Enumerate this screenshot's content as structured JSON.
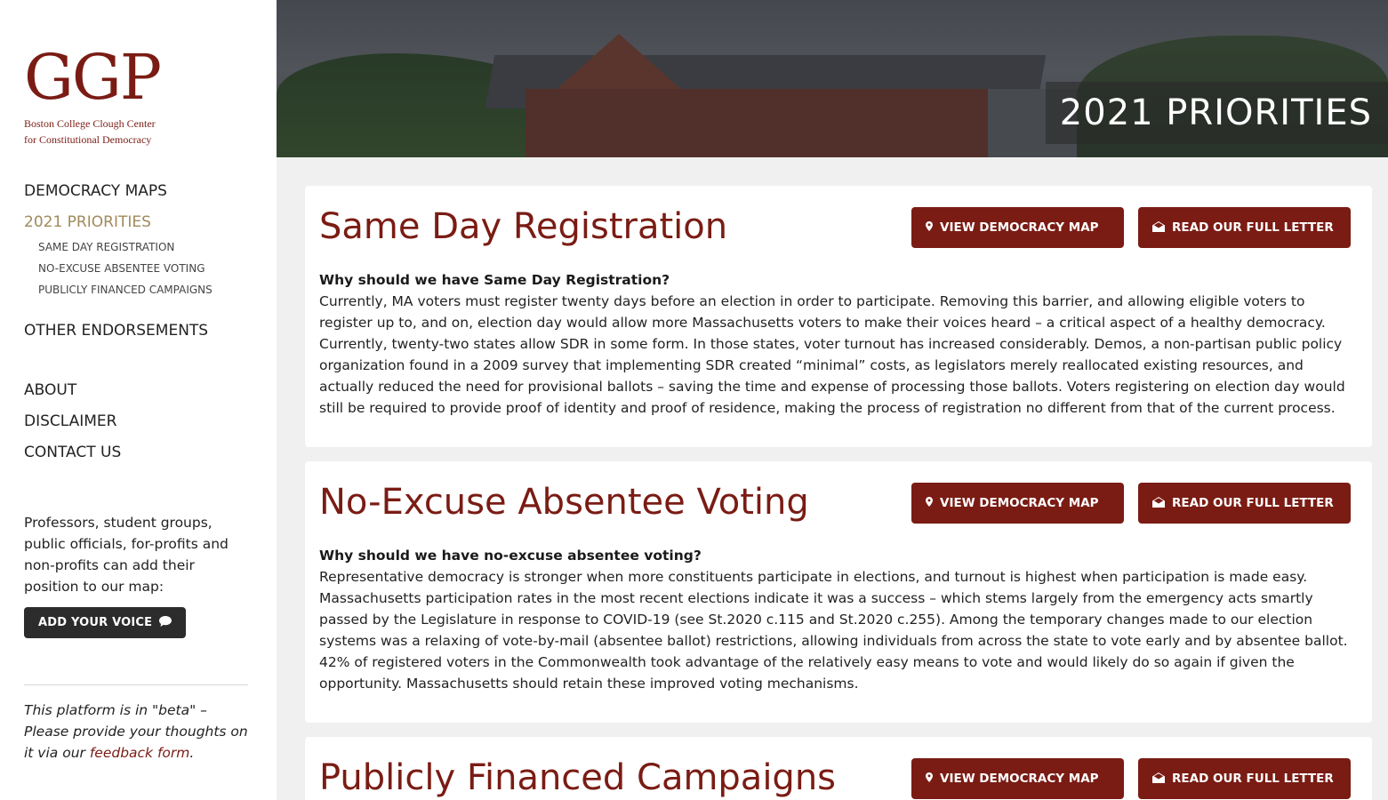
{
  "logo": {
    "mark": "GGP",
    "line1": "Boston College Clough Center",
    "line2": "for Constitutional Democracy"
  },
  "nav": {
    "democracy_maps": "DEMOCRACY MAPS",
    "priorities": "2021 PRIORITIES",
    "sub": [
      "SAME DAY REGISTRATION",
      "NO-EXCUSE ABSENTEE VOTING",
      "PUBLICLY FINANCED CAMPAIGNS"
    ],
    "other": "OTHER ENDORSEMENTS",
    "about": "ABOUT",
    "disclaimer": "DISCLAIMER",
    "contact": "CONTACT US"
  },
  "promo": {
    "text": "Professors, student groups, public officials, for-profits and non-profits can add their position to our map:",
    "button": "ADD YOUR VOICE"
  },
  "beta": {
    "before": "This platform is in \"beta\" – Please provide your thoughts on it via our ",
    "link": "feedback form",
    "after": "."
  },
  "banner": {
    "title": "2021 PRIORITIES"
  },
  "buttons": {
    "map": "VIEW DEMOCRACY MAP",
    "letter": "READ OUR FULL LETTER"
  },
  "cards": [
    {
      "title": "Same Day Registration",
      "question": "Why should we have Same Day Registration?",
      "body": "Currently, MA voters must register twenty days before an election in order to participate. Removing this barrier, and allowing eligible voters to register up to, and on, election day would allow more Massachusetts voters to make their voices heard – a critical aspect of a healthy democracy. Currently, twenty-two states allow SDR in some form. In those states, voter turnout has increased considerably. Demos, a non-partisan public policy organization found in a 2009 survey that implementing SDR created “minimal” costs, as legislators merely reallocated existing resources, and actually reduced the need for provisional ballots – saving the time and expense of processing those ballots. Voters registering on election day would still be required to provide proof of identity and proof of residence, making the process of registration no different from that of the current process."
    },
    {
      "title": "No-Excuse Absentee Voting",
      "question": "Why should we have no-excuse absentee voting?",
      "body": "Representative democracy is stronger when more constituents participate in elections, and turnout is highest when participation is made easy. Massachusetts participation rates in the most recent elections indicate it was a success – which stems largely from the emergency acts smartly passed by the Legislature in response to COVID-19 (see St.2020 c.115 and St.2020 c.255). Among the temporary changes made to our election systems was a relaxing of vote-by-mail (absentee ballot) restrictions, allowing individuals from across the state to vote early and by absentee ballot. 42% of registered voters in the Commonwealth took advantage of the relatively easy means to vote and would likely do so again if given the opportunity. Massachusetts should retain these improved voting mechanisms."
    },
    {
      "title": "Publicly Financed Campaigns"
    }
  ]
}
